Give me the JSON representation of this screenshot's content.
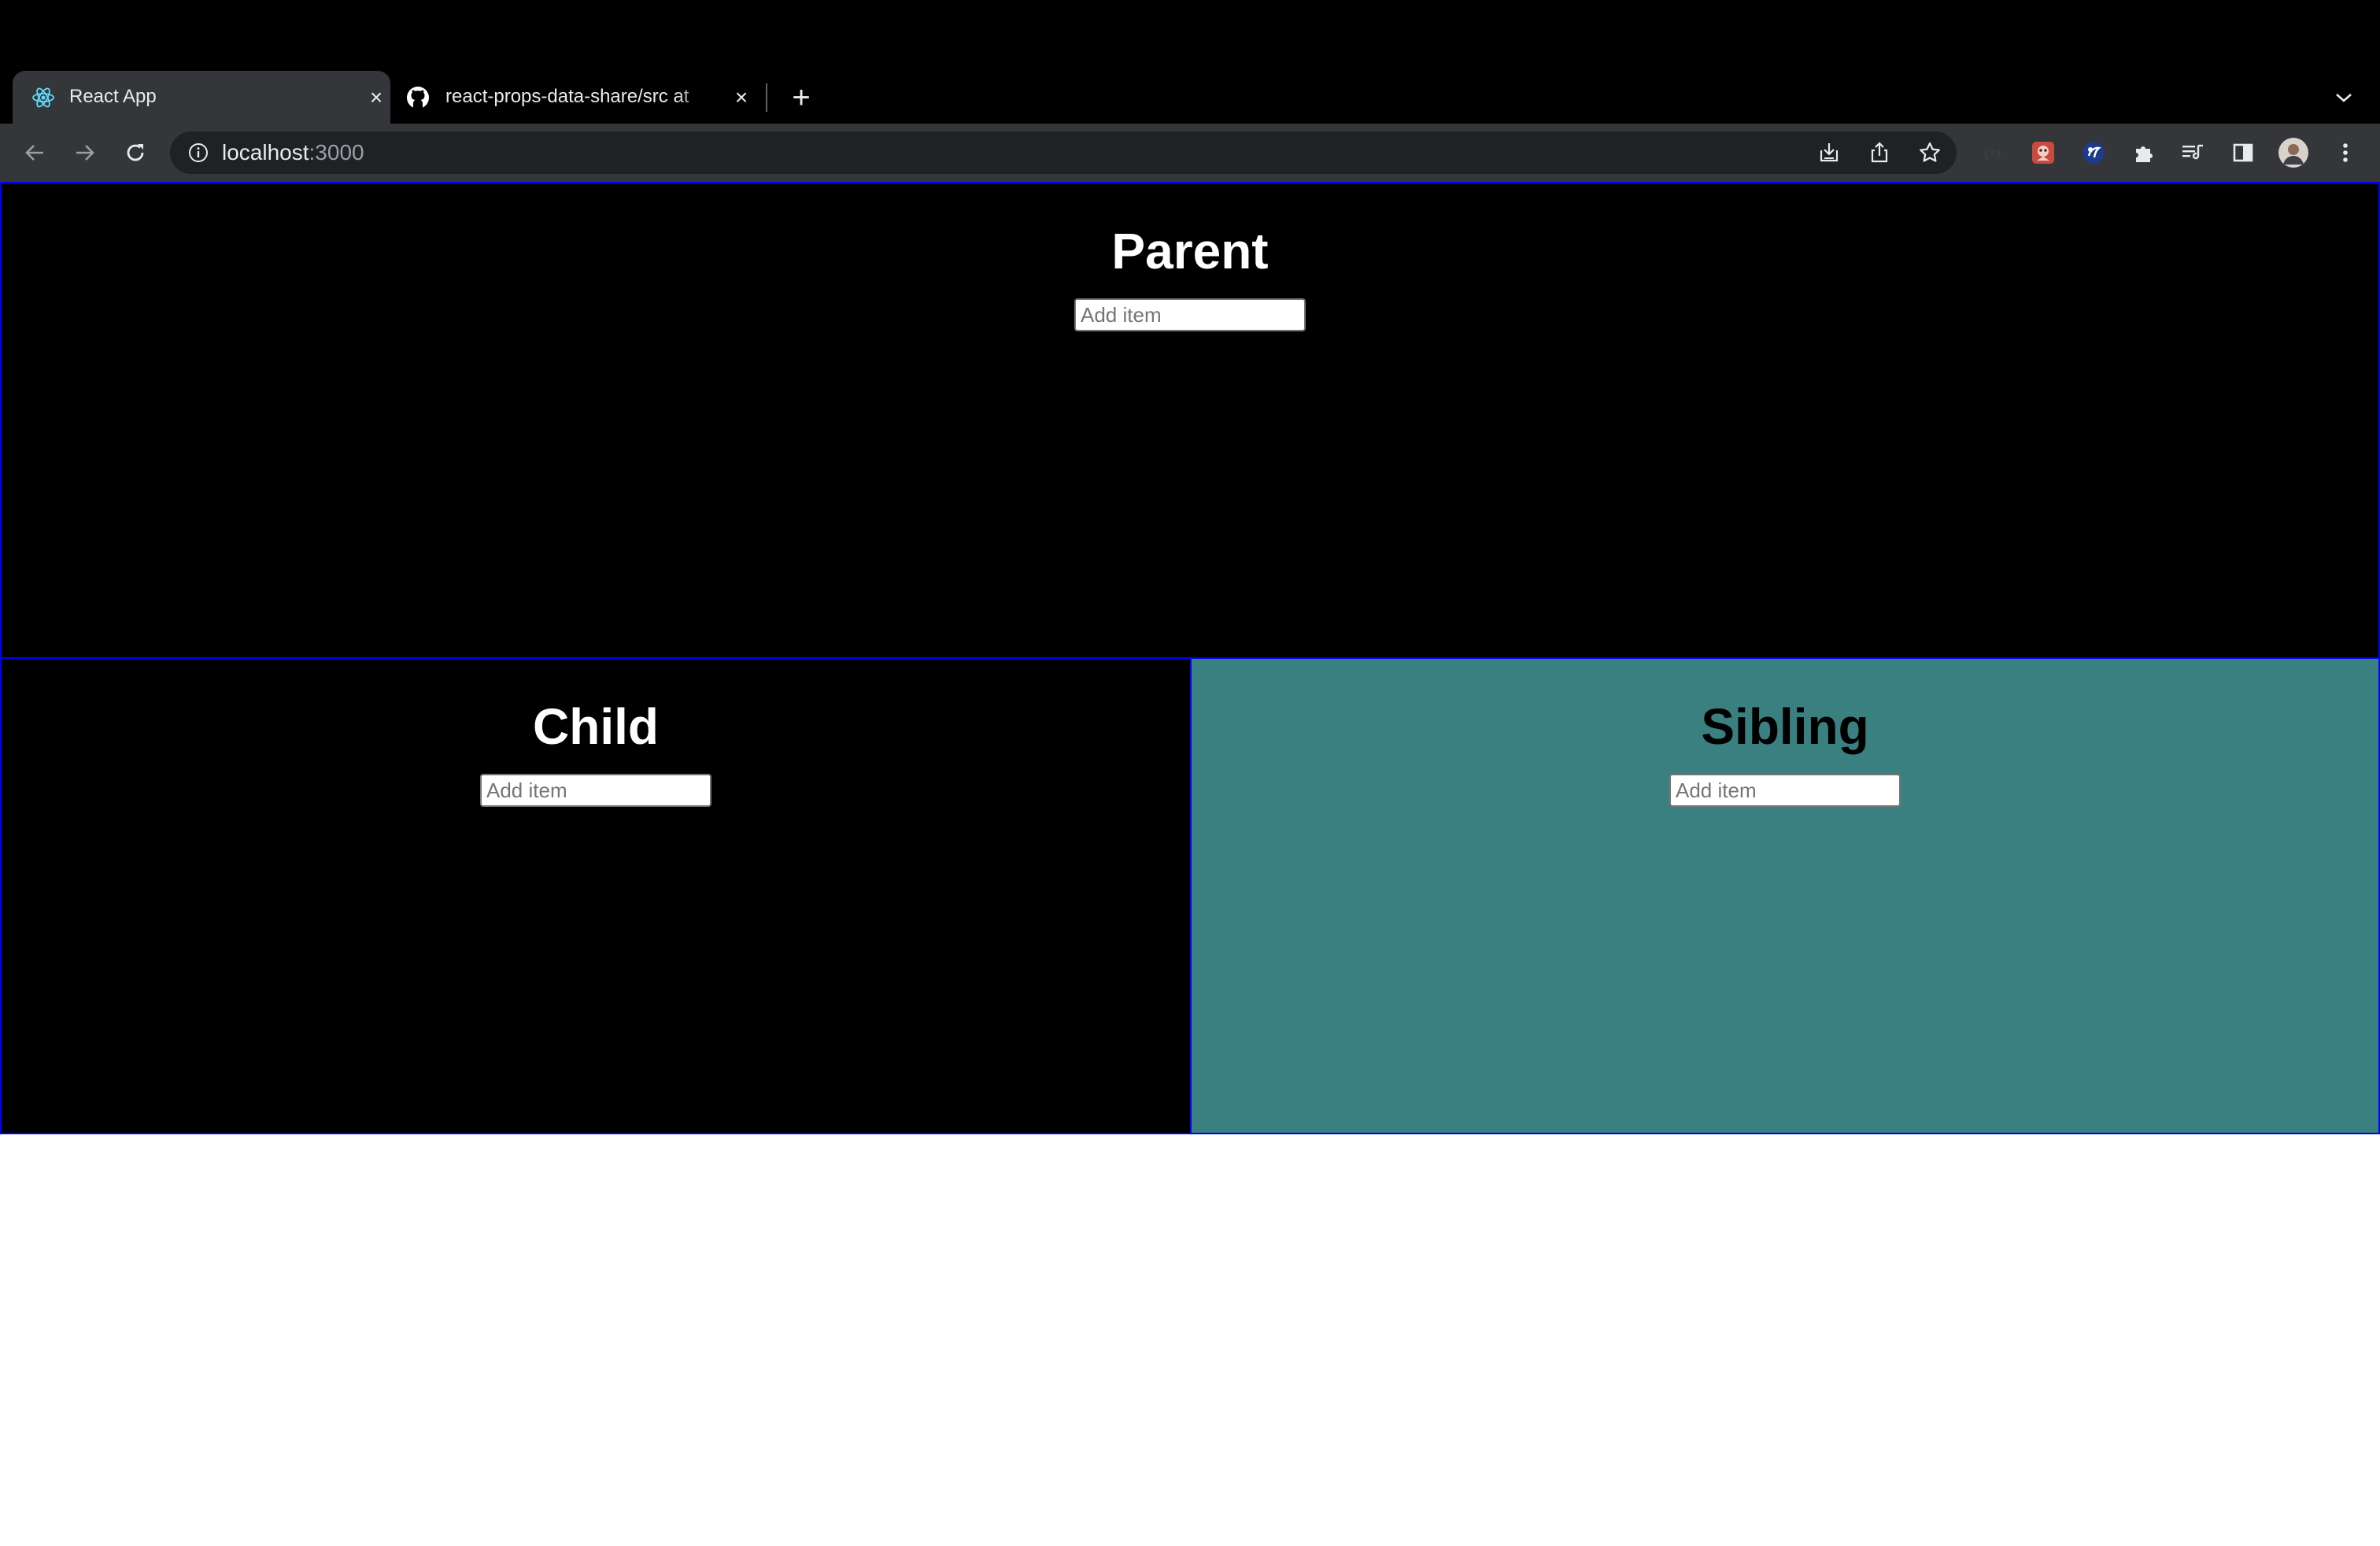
{
  "browser": {
    "tabs": [
      {
        "title": "React App",
        "icon": "react-logo-icon",
        "active": true
      },
      {
        "title": "react-props-data-share/src at",
        "icon": "github-icon",
        "active": false
      }
    ],
    "address_bar": {
      "host": "localhost",
      "port": ":3000"
    },
    "colors": {
      "frame": "#000000",
      "toolbar": "#35363a",
      "omnibox": "#202124"
    }
  },
  "page": {
    "parent": {
      "heading": "Parent",
      "input_placeholder": "Add item",
      "input_value": ""
    },
    "child": {
      "heading": "Child",
      "input_placeholder": "Add item",
      "input_value": ""
    },
    "sibling": {
      "heading": "Sibling",
      "input_placeholder": "Add item",
      "input_value": ""
    },
    "colors": {
      "panel_dark": "#000000",
      "panel_sibling": "#3a8080",
      "panel_border": "#0000ff"
    }
  }
}
